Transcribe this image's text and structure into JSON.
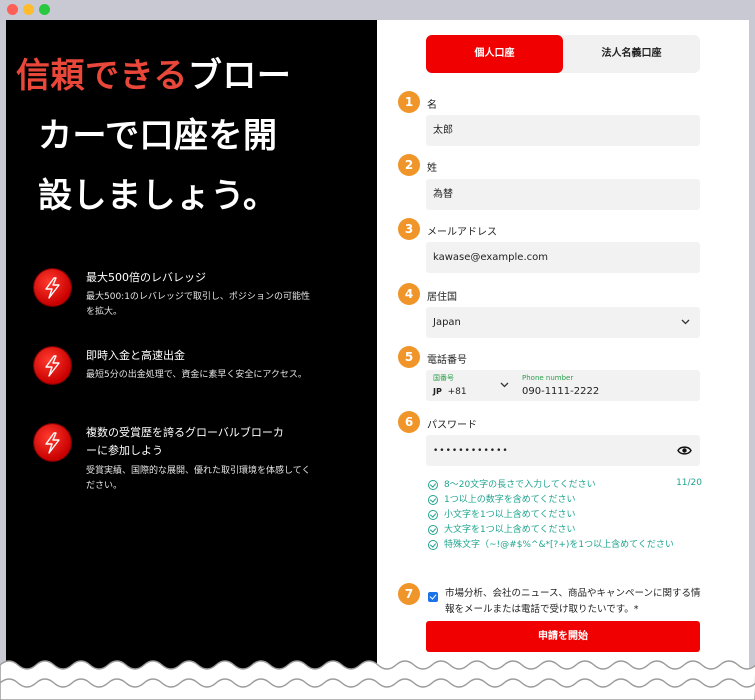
{
  "colors": {
    "accent": "#f00000",
    "badge": "#f0952a",
    "rule": "#20a58f",
    "headline_highlight": "#e8473a"
  },
  "hero": {
    "highlight": "信頼できる",
    "line1_rest": "ブロー",
    "line2": "カーで口座を開",
    "line3": "設しましょう。"
  },
  "features": [
    {
      "icon": "lightning-icon",
      "title": "最大500倍のレバレッジ",
      "desc": "最大500:1のレバレッジで取引し、ポジションの可能性を拡大。"
    },
    {
      "icon": "lightning-icon",
      "title": "即時入金と高速出金",
      "desc": "最短5分の出金処理で、資金に素早く安全にアクセス。"
    },
    {
      "icon": "lightning-icon",
      "title": "複数の受賞歴を誇るグローバルブローカーに参加しよう",
      "desc": "受賞実績、国際的な展開、優れた取引環境を体感してください。"
    }
  ],
  "tabs": [
    "個人口座",
    "法人名義口座"
  ],
  "form": {
    "first_name": {
      "num": "1",
      "label": "名",
      "value": "太郎"
    },
    "last_name": {
      "num": "2",
      "label": "姓",
      "value": "為替"
    },
    "email": {
      "num": "3",
      "label": "メールアドレス",
      "value": "kawase@example.com"
    },
    "country": {
      "num": "4",
      "label": "居住国",
      "value": "Japan"
    },
    "phone": {
      "num": "5",
      "label": "電話番号",
      "code_label": "国番号",
      "country_code": "JP",
      "dial": "+81",
      "number_label": "Phone number",
      "number": "090-1111-2222"
    },
    "password": {
      "num": "6",
      "label": "パスワード",
      "value": "••••••••••••",
      "counter": "11/20"
    },
    "consent": {
      "num": "7",
      "text": "市場分析、会社のニュース、商品やキャンペーンに関する情報をメールまたは電話で受け取りたいです。*"
    }
  },
  "password_rules": [
    "8〜20文字の長さで入力してください",
    "1つ以上の数字を含めてください",
    "小文字を1つ以上含めてください",
    "大文字を1つ以上含めてください",
    "特殊文字（~!@#$%^&*[?+)を1つ以上含めてください"
  ],
  "submit_label": "申請を開始"
}
